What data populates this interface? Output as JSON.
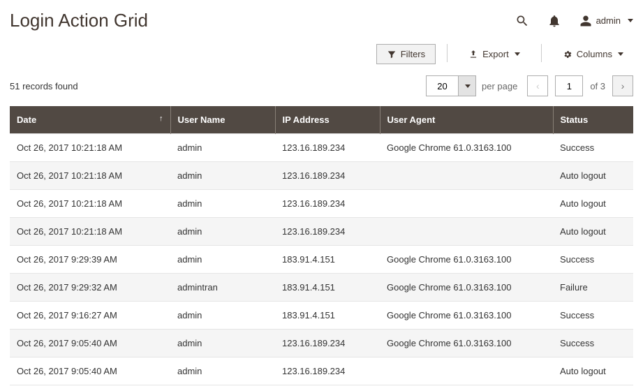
{
  "header": {
    "title": "Login Action Grid",
    "username": "admin"
  },
  "toolbar": {
    "filters_label": "Filters",
    "export_label": "Export",
    "columns_label": "Columns"
  },
  "pagination": {
    "records_found": "51 records found",
    "per_page_value": "20",
    "per_page_label": "per page",
    "current_page": "1",
    "of_label": "of 3"
  },
  "table": {
    "columns": [
      {
        "label": "Date",
        "sort": "asc"
      },
      {
        "label": "User Name"
      },
      {
        "label": "IP Address"
      },
      {
        "label": "User Agent"
      },
      {
        "label": "Status"
      }
    ],
    "rows": [
      {
        "date": "Oct 26, 2017 10:21:18 AM",
        "user": "admin",
        "ip": "123.16.189.234",
        "agent": "Google Chrome 61.0.3163.100",
        "status": "Success"
      },
      {
        "date": "Oct 26, 2017 10:21:18 AM",
        "user": "admin",
        "ip": "123.16.189.234",
        "agent": "",
        "status": "Auto logout"
      },
      {
        "date": "Oct 26, 2017 10:21:18 AM",
        "user": "admin",
        "ip": "123.16.189.234",
        "agent": "",
        "status": "Auto logout"
      },
      {
        "date": "Oct 26, 2017 10:21:18 AM",
        "user": "admin",
        "ip": "123.16.189.234",
        "agent": "",
        "status": "Auto logout"
      },
      {
        "date": "Oct 26, 2017 9:29:39 AM",
        "user": "admin",
        "ip": "183.91.4.151",
        "agent": "Google Chrome 61.0.3163.100",
        "status": "Success"
      },
      {
        "date": "Oct 26, 2017 9:29:32 AM",
        "user": "admintran",
        "ip": "183.91.4.151",
        "agent": "Google Chrome 61.0.3163.100",
        "status": "Failure"
      },
      {
        "date": "Oct 26, 2017 9:16:27 AM",
        "user": "admin",
        "ip": "183.91.4.151",
        "agent": "Google Chrome 61.0.3163.100",
        "status": "Success"
      },
      {
        "date": "Oct 26, 2017 9:05:40 AM",
        "user": "admin",
        "ip": "123.16.189.234",
        "agent": "Google Chrome 61.0.3163.100",
        "status": "Success"
      },
      {
        "date": "Oct 26, 2017 9:05:40 AM",
        "user": "admin",
        "ip": "123.16.189.234",
        "agent": "",
        "status": "Auto logout"
      }
    ]
  }
}
